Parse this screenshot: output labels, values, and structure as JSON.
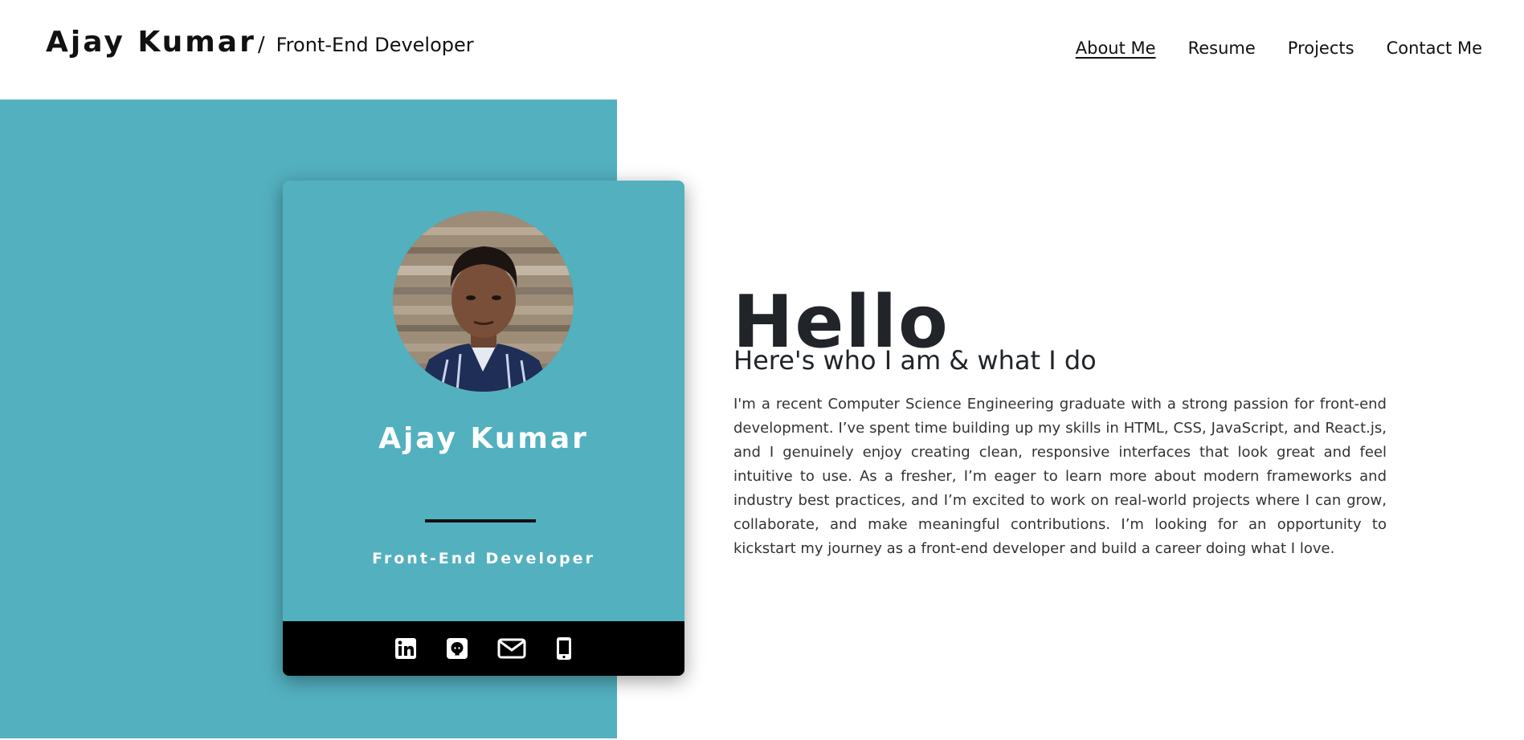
{
  "header": {
    "brand_name": "Ajay Kumar",
    "brand_separator": "/",
    "brand_subtitle": "Front-End Developer",
    "nav": [
      {
        "label": "About Me",
        "active": true
      },
      {
        "label": "Resume",
        "active": false
      },
      {
        "label": "Projects",
        "active": false
      },
      {
        "label": "Contact Me",
        "active": false
      }
    ]
  },
  "card": {
    "name": "Ajay Kumar",
    "role": "Front-End Developer",
    "social_icons": [
      "linkedin-icon",
      "github-icon",
      "mail-icon",
      "phone-icon"
    ]
  },
  "intro": {
    "heading": "Hello",
    "tagline": "Here's who I am & what I do",
    "bio": "I'm a recent Computer Science Engineering graduate with a strong passion for front-end development. I’ve spent time building up my skills in HTML, CSS, JavaScript, and React.js, and I genuinely enjoy creating clean, responsive interfaces that look great and feel intuitive to use. As a fresher, I’m eager to learn more about modern frameworks and industry best practices, and I’m excited to work on real-world projects where I can grow, collaborate, and make meaningful contributions. I’m looking for an opportunity to kickstart my journey as a front-end developer and build a career doing what I love."
  },
  "colors": {
    "accent_teal": "#53b0bf",
    "text_dark": "#212529",
    "card_footer": "#000000"
  }
}
